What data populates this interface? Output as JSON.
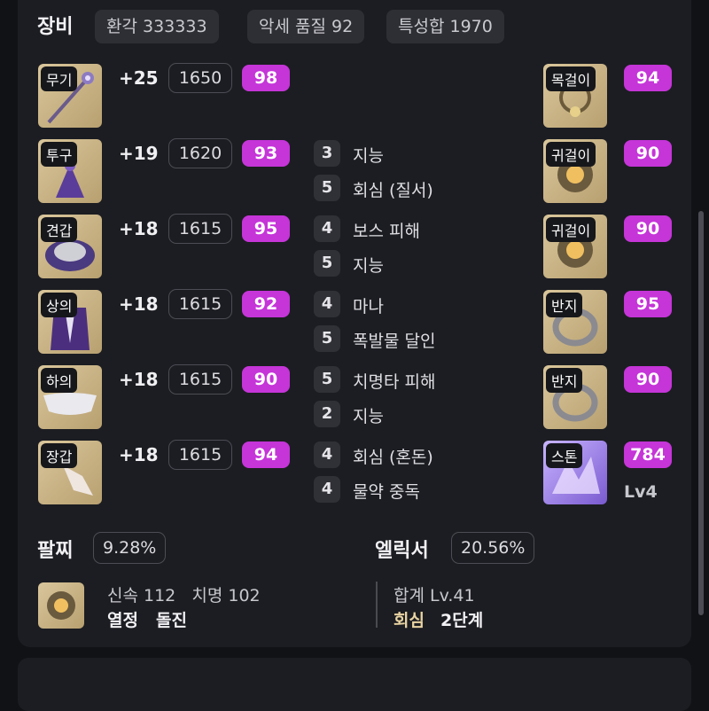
{
  "header": {
    "title": "장비",
    "chips": [
      "환각 333333",
      "악세 품질 92",
      "특성합 1970"
    ]
  },
  "armor": [
    {
      "slot": "무기",
      "plus": "+25",
      "level": "1650",
      "quality": "98"
    },
    {
      "slot": "투구",
      "plus": "+19",
      "level": "1620",
      "quality": "93"
    },
    {
      "slot": "견갑",
      "plus": "+18",
      "level": "1615",
      "quality": "95"
    },
    {
      "slot": "상의",
      "plus": "+18",
      "level": "1615",
      "quality": "92"
    },
    {
      "slot": "하의",
      "plus": "+18",
      "level": "1615",
      "quality": "90"
    },
    {
      "slot": "장갑",
      "plus": "+18",
      "level": "1615",
      "quality": "94"
    }
  ],
  "engravings": [
    {
      "level": "3",
      "name": "지능"
    },
    {
      "level": "5",
      "name": "회심 (질서)"
    },
    {
      "level": "4",
      "name": "보스 피해"
    },
    {
      "level": "5",
      "name": "지능"
    },
    {
      "level": "4",
      "name": "마나"
    },
    {
      "level": "5",
      "name": "폭발물 달인"
    },
    {
      "level": "5",
      "name": "치명타 피해"
    },
    {
      "level": "2",
      "name": "지능"
    },
    {
      "level": "4",
      "name": "회심 (혼돈)"
    },
    {
      "level": "4",
      "name": "물약 중독"
    }
  ],
  "accessories": [
    {
      "slot": "목걸이",
      "quality": "94"
    },
    {
      "slot": "귀걸이",
      "quality": "90"
    },
    {
      "slot": "귀걸이",
      "quality": "90"
    },
    {
      "slot": "반지",
      "quality": "95"
    },
    {
      "slot": "반지",
      "quality": "90"
    },
    {
      "slot": "스톤",
      "quality": "784",
      "sub": "Lv4"
    }
  ],
  "bracelet": {
    "title": "팔찌",
    "percent": "9.28%",
    "stats": "신속 112   치명 102",
    "effect1": "열정",
    "effect2": "돌진"
  },
  "elixir": {
    "title": "엘릭서",
    "percent": "20.56%",
    "total": "합계 Lv.41",
    "effect_name": "회심",
    "effect_level": "2단계"
  },
  "colors": {
    "quality_badge": "#c535d8",
    "background": "#1c1d22",
    "elixir_effect": "#e8d3a2"
  }
}
